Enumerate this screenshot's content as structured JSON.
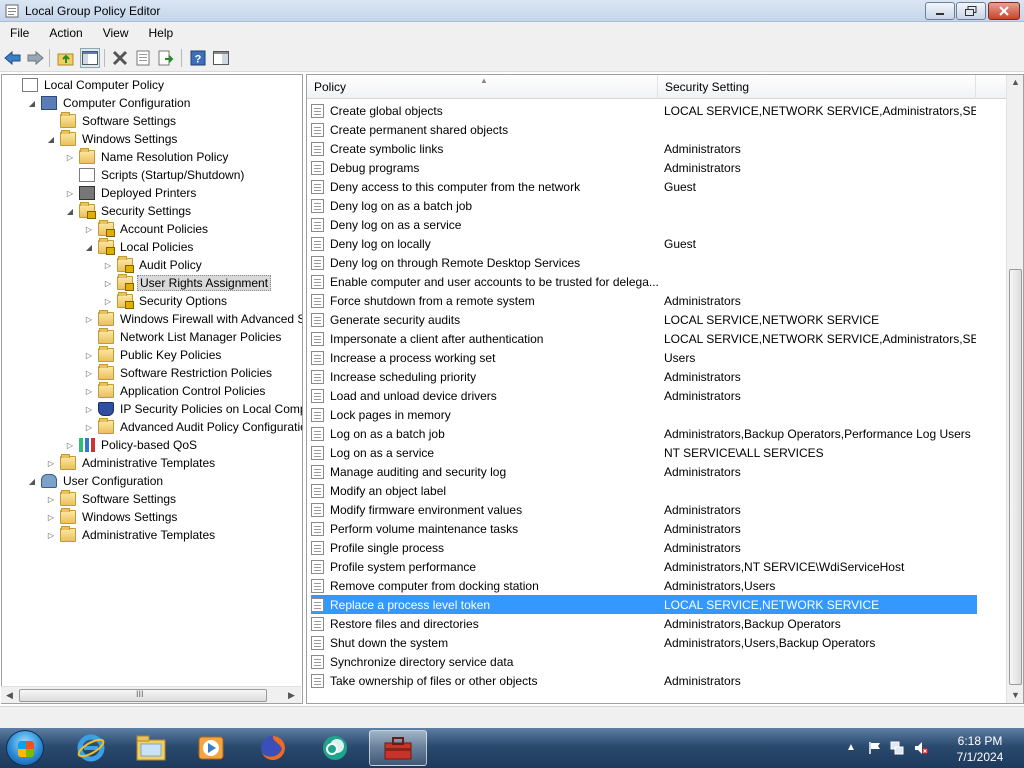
{
  "window": {
    "title": "Local Group Policy Editor"
  },
  "menu": [
    "File",
    "Action",
    "View",
    "Help"
  ],
  "toolbar": [
    "back-arrow-icon",
    "forward-arrow-icon",
    "up-folder-icon",
    "show-hide-tree-icon",
    "delete-icon",
    "properties-icon",
    "export-list-icon",
    "help-icon",
    "console-icon"
  ],
  "tree": {
    "items": [
      {
        "label": "Local Computer Policy",
        "depth": 0,
        "expander": "none",
        "icon": "doc"
      },
      {
        "label": "Computer Configuration",
        "depth": 1,
        "expander": "expanded",
        "icon": "computer"
      },
      {
        "label": "Software Settings",
        "depth": 2,
        "expander": "none",
        "icon": "folder"
      },
      {
        "label": "Windows Settings",
        "depth": 2,
        "expander": "expanded",
        "icon": "folder"
      },
      {
        "label": "Name Resolution Policy",
        "depth": 3,
        "expander": "collapsed",
        "icon": "folder"
      },
      {
        "label": "Scripts (Startup/Shutdown)",
        "depth": 3,
        "expander": "none",
        "icon": "doc"
      },
      {
        "label": "Deployed Printers",
        "depth": 3,
        "expander": "collapsed",
        "icon": "printer"
      },
      {
        "label": "Security Settings",
        "depth": 3,
        "expander": "expanded",
        "icon": "folder-lock"
      },
      {
        "label": "Account Policies",
        "depth": 4,
        "expander": "collapsed",
        "icon": "folder-lock"
      },
      {
        "label": "Local Policies",
        "depth": 4,
        "expander": "expanded",
        "icon": "folder-lock"
      },
      {
        "label": "Audit Policy",
        "depth": 5,
        "expander": "collapsed",
        "icon": "folder-lock"
      },
      {
        "label": "User Rights Assignment",
        "depth": 5,
        "expander": "collapsed",
        "icon": "folder-lock",
        "selected": true
      },
      {
        "label": "Security Options",
        "depth": 5,
        "expander": "collapsed",
        "icon": "folder-lock"
      },
      {
        "label": "Windows Firewall with Advanced Secu",
        "depth": 4,
        "expander": "collapsed",
        "icon": "folder"
      },
      {
        "label": "Network List Manager Policies",
        "depth": 4,
        "expander": "none",
        "icon": "folder"
      },
      {
        "label": "Public Key Policies",
        "depth": 4,
        "expander": "collapsed",
        "icon": "folder"
      },
      {
        "label": "Software Restriction Policies",
        "depth": 4,
        "expander": "collapsed",
        "icon": "folder"
      },
      {
        "label": "Application Control Policies",
        "depth": 4,
        "expander": "collapsed",
        "icon": "folder"
      },
      {
        "label": "IP Security Policies on Local Compute",
        "depth": 4,
        "expander": "collapsed",
        "icon": "shield"
      },
      {
        "label": "Advanced Audit Policy Configuration",
        "depth": 4,
        "expander": "collapsed",
        "icon": "folder"
      },
      {
        "label": "Policy-based QoS",
        "depth": 3,
        "expander": "collapsed",
        "icon": "bars"
      },
      {
        "label": "Administrative Templates",
        "depth": 2,
        "expander": "collapsed",
        "icon": "folder"
      },
      {
        "label": "User Configuration",
        "depth": 1,
        "expander": "expanded",
        "icon": "users"
      },
      {
        "label": "Software Settings",
        "depth": 2,
        "expander": "collapsed",
        "icon": "folder"
      },
      {
        "label": "Windows Settings",
        "depth": 2,
        "expander": "collapsed",
        "icon": "folder"
      },
      {
        "label": "Administrative Templates",
        "depth": 2,
        "expander": "collapsed",
        "icon": "folder"
      }
    ],
    "scroll_label": "III"
  },
  "list": {
    "columns": [
      "Policy",
      "Security Setting"
    ],
    "rows": [
      {
        "policy": "Create global objects",
        "setting": "LOCAL SERVICE,NETWORK SERVICE,Administrators,SER..."
      },
      {
        "policy": "Create permanent shared objects",
        "setting": ""
      },
      {
        "policy": "Create symbolic links",
        "setting": "Administrators"
      },
      {
        "policy": "Debug programs",
        "setting": "Administrators"
      },
      {
        "policy": "Deny access to this computer from the network",
        "setting": "Guest"
      },
      {
        "policy": "Deny log on as a batch job",
        "setting": ""
      },
      {
        "policy": "Deny log on as a service",
        "setting": ""
      },
      {
        "policy": "Deny log on locally",
        "setting": "Guest"
      },
      {
        "policy": "Deny log on through Remote Desktop Services",
        "setting": ""
      },
      {
        "policy": "Enable computer and user accounts to be trusted for delega...",
        "setting": ""
      },
      {
        "policy": "Force shutdown from a remote system",
        "setting": "Administrators"
      },
      {
        "policy": "Generate security audits",
        "setting": "LOCAL SERVICE,NETWORK SERVICE"
      },
      {
        "policy": "Impersonate a client after authentication",
        "setting": "LOCAL SERVICE,NETWORK SERVICE,Administrators,SER..."
      },
      {
        "policy": "Increase a process working set",
        "setting": "Users"
      },
      {
        "policy": "Increase scheduling priority",
        "setting": "Administrators"
      },
      {
        "policy": "Load and unload device drivers",
        "setting": "Administrators"
      },
      {
        "policy": "Lock pages in memory",
        "setting": ""
      },
      {
        "policy": "Log on as a batch job",
        "setting": "Administrators,Backup Operators,Performance Log Users"
      },
      {
        "policy": "Log on as a service",
        "setting": "NT SERVICE\\ALL SERVICES"
      },
      {
        "policy": "Manage auditing and security log",
        "setting": "Administrators"
      },
      {
        "policy": "Modify an object label",
        "setting": ""
      },
      {
        "policy": "Modify firmware environment values",
        "setting": "Administrators"
      },
      {
        "policy": "Perform volume maintenance tasks",
        "setting": "Administrators"
      },
      {
        "policy": "Profile single process",
        "setting": "Administrators"
      },
      {
        "policy": "Profile system performance",
        "setting": "Administrators,NT SERVICE\\WdiServiceHost"
      },
      {
        "policy": "Remove computer from docking station",
        "setting": "Administrators,Users"
      },
      {
        "policy": "Replace a process level token",
        "setting": "LOCAL SERVICE,NETWORK SERVICE",
        "selected": true
      },
      {
        "policy": "Restore files and directories",
        "setting": "Administrators,Backup Operators"
      },
      {
        "policy": "Shut down the system",
        "setting": "Administrators,Users,Backup Operators"
      },
      {
        "policy": "Synchronize directory service data",
        "setting": ""
      },
      {
        "policy": "Take ownership of files or other objects",
        "setting": "Administrators"
      }
    ]
  },
  "taskbar": {
    "apps": [
      "internet-explorer-icon",
      "windows-explorer-icon",
      "media-player-icon",
      "firefox-icon",
      "chat-app-icon",
      "group-policy-toolbox-icon"
    ],
    "active_app": "group-policy-toolbox-icon",
    "clock": {
      "time": "6:18 PM",
      "date": "7/1/2024"
    }
  },
  "colors": {
    "selection": "#3399ff",
    "tree_selection": "#d9d9d9"
  }
}
